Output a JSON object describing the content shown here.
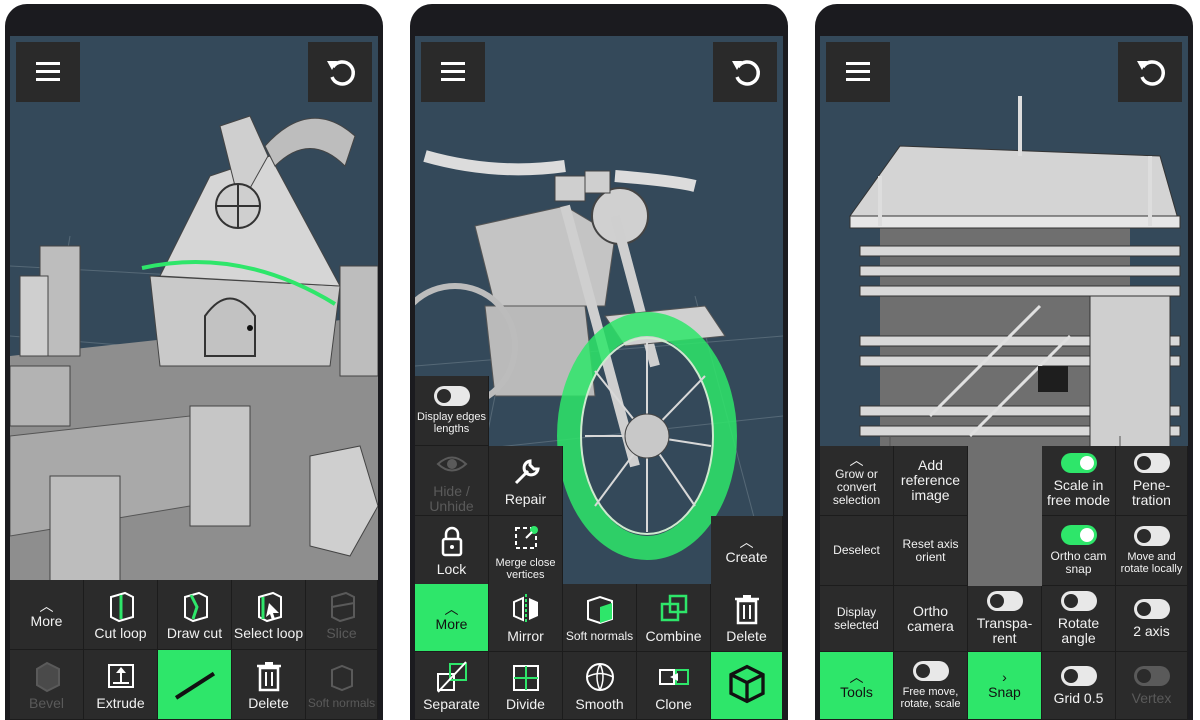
{
  "colors": {
    "accent": "#2ee66a",
    "viewport": "#34495a",
    "panel": "#2b2b2b"
  },
  "phone1": {
    "menu_icon": "hamburger-icon",
    "undo_icon": "undo-icon",
    "row1": [
      {
        "label": "More",
        "icon": "chevron-up-icon"
      },
      {
        "label": "Cut loop",
        "icon": "cut-loop-icon"
      },
      {
        "label": "Draw cut",
        "icon": "draw-cut-icon"
      },
      {
        "label": "Select loop",
        "icon": "select-loop-icon"
      },
      {
        "label": "Slice",
        "icon": "slice-icon"
      }
    ],
    "row2": [
      {
        "label": "Bevel",
        "icon": "bevel-icon"
      },
      {
        "label": "Extrude",
        "icon": "extrude-icon"
      },
      {
        "label": "",
        "icon": "line-tool-icon"
      },
      {
        "label": "Delete",
        "icon": "trash-icon"
      },
      {
        "label": "Soft normals",
        "icon": "soft-normals-icon"
      }
    ]
  },
  "phone2": {
    "menu_icon": "hamburger-icon",
    "undo_icon": "undo-icon",
    "display_edges": "Display edges lengths",
    "hide_unhide": "Hide / Unhide",
    "repair": "Repair",
    "lock": "Lock",
    "merge": "Merge close vertices",
    "create": "Create",
    "row1": [
      {
        "label": "More",
        "icon": "chevron-up-icon"
      },
      {
        "label": "Mirror",
        "icon": "mirror-icon"
      },
      {
        "label": "Soft normals",
        "icon": "soft-normals-icon"
      },
      {
        "label": "Combine",
        "icon": "combine-icon"
      },
      {
        "label": "Delete",
        "icon": "trash-icon"
      }
    ],
    "row2": [
      {
        "label": "Separate",
        "icon": "separate-icon"
      },
      {
        "label": "Divide",
        "icon": "divide-icon"
      },
      {
        "label": "Smooth",
        "icon": "smooth-icon"
      },
      {
        "label": "Clone",
        "icon": "clone-icon"
      },
      {
        "label": "",
        "icon": "cube-icon"
      }
    ]
  },
  "phone3": {
    "menu_icon": "hamburger-icon",
    "undo_icon": "undo-icon",
    "rows": [
      [
        "Grow or convert selection",
        "Add reference image",
        "Scale in free mode",
        "Pene-tration"
      ],
      [
        "Deselect",
        "Reset axis orient",
        "Ortho cam snap",
        "Move and rotate locally"
      ],
      [
        "Display selected",
        "Ortho camera",
        "Transpa-rent",
        "Rotate angle",
        "2 axis"
      ],
      [
        "Tools",
        "Free move, rotate, scale",
        "Snap",
        "Grid 0.5",
        "Vertex"
      ]
    ]
  }
}
